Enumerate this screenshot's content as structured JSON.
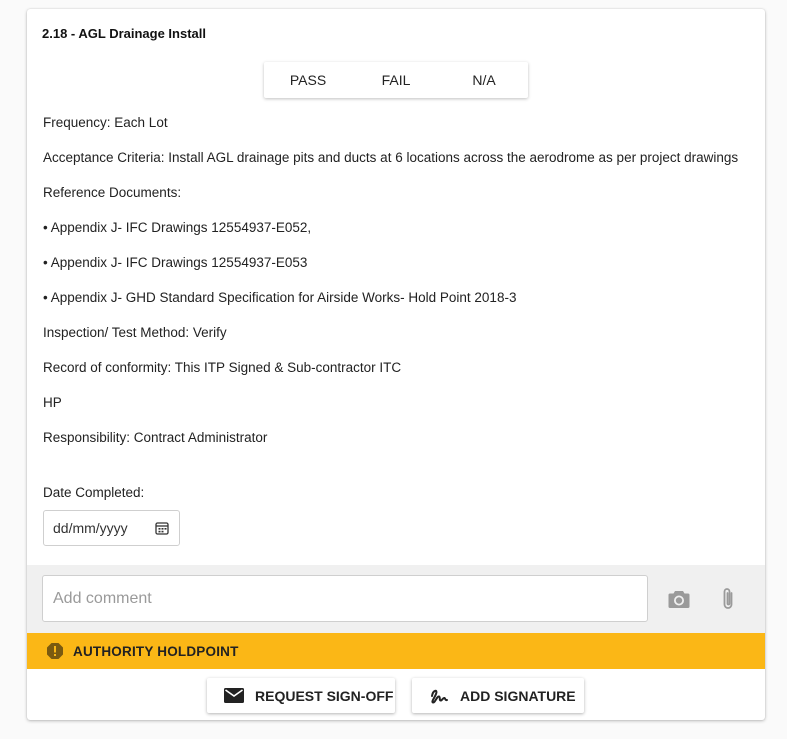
{
  "item": {
    "title": "2.18 - AGL Drainage Install",
    "options": [
      "PASS",
      "FAIL",
      "N/A"
    ]
  },
  "details": {
    "frequency": "Frequency: Each Lot",
    "acceptance": "Acceptance Criteria: Install AGL drainage pits and ducts at 6 locations across the aerodrome as per project drawings",
    "reference_heading": "Reference Documents:",
    "references": [
      "• Appendix J- IFC Drawings 12554937-E052,",
      "• Appendix J- IFC Drawings 12554937-E053",
      "• Appendix J- GHD Standard Specification for Airside Works- Hold Point 2018-3"
    ],
    "inspection": "Inspection/ Test Method: Verify",
    "record": "Record of conformity: This ITP Signed & Sub-contractor ITC",
    "hp": "HP",
    "responsibility": "Responsibility: Contract Administrator"
  },
  "date": {
    "label": "Date Completed:",
    "placeholder": "dd/mm/yyyy"
  },
  "comment": {
    "placeholder": "Add comment"
  },
  "holdpoint": {
    "label": "AUTHORITY HOLDPOINT",
    "color": "#fbb716"
  },
  "actions": {
    "request_signoff": "REQUEST SIGN-OFF",
    "add_signature": "ADD SIGNATURE"
  }
}
